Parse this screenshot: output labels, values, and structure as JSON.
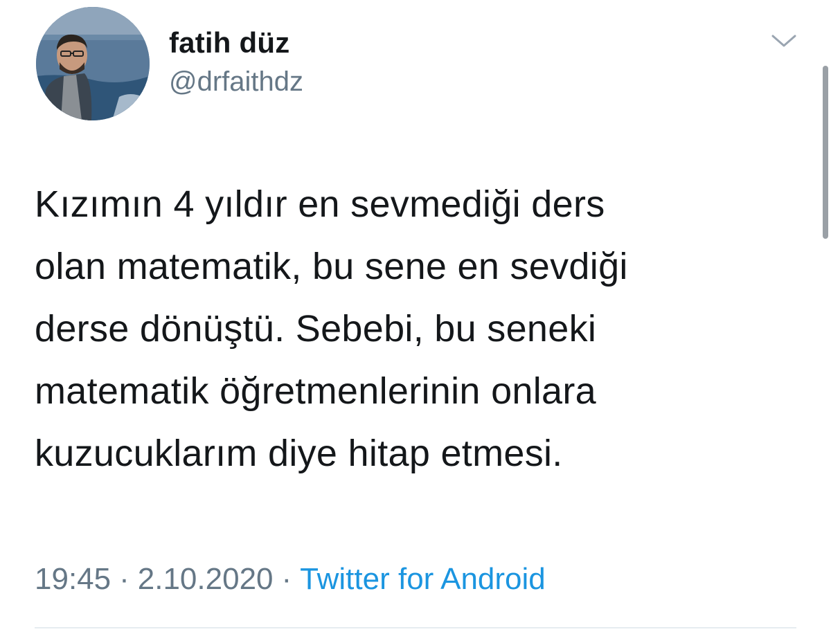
{
  "author": {
    "display_name": "fatih düz",
    "handle": "@drfaithdz",
    "avatar_icon": "profile-photo"
  },
  "menu": {
    "icon": "chevron-down-icon"
  },
  "tweet": {
    "lines": [
      "Kızımın 4 yıldır en sevmediği ders",
      "olan matematik, bu sene en sevdiği",
      "derse dönüştü. Sebebi, bu seneki",
      "matematik öğretmenlerinin onlara",
      "kuzucuklarım diye hitap etmesi."
    ]
  },
  "meta": {
    "time": "19:45",
    "separator": "·",
    "date": "2.10.2020",
    "source": "Twitter for Android"
  },
  "colors": {
    "text": "#14171a",
    "secondary": "#657786",
    "link": "#1b95e0",
    "divider": "#e6ecf0"
  }
}
